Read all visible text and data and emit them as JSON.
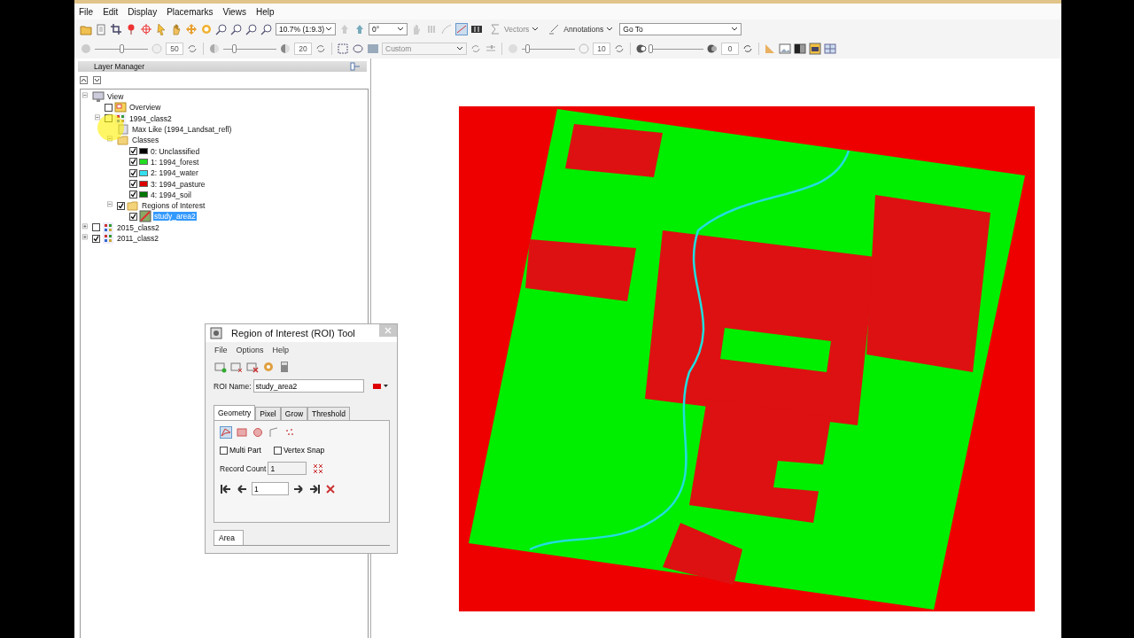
{
  "menu": [
    "File",
    "Edit",
    "Display",
    "Placemarks",
    "Views",
    "Help"
  ],
  "toolbar": {
    "zoom": "10.7% (1:9.3)",
    "rotation": "0°",
    "vectors": "Vectors",
    "annotations": "Annotations",
    "goto": "Go To"
  },
  "adjust_bar": {
    "sliders": [
      {
        "level": 0.5,
        "reading": "50"
      },
      {
        "level": 0.2,
        "reading": "20"
      }
    ],
    "stretch": "Custom",
    "sliders2": [
      {
        "level": 0.1,
        "reading": "10"
      },
      {
        "level": 0.0,
        "reading": "0"
      }
    ]
  },
  "layer_manager": {
    "title": "Layer Manager",
    "tree": [
      {
        "label": "View",
        "kind": "view",
        "expanded": true,
        "selected": false,
        "children": [
          {
            "label": "Overview",
            "kind": "overview",
            "checked": false,
            "selected": false
          },
          {
            "label": "1994_class2",
            "kind": "layer",
            "checked": false,
            "expanded": true,
            "selected": false,
            "children": [
              {
                "label": "Max Like (1994_Landsat_refl)",
                "kind": "file",
                "selected": false
              },
              {
                "label": "Classes",
                "kind": "folder",
                "expanded": true,
                "selected": false,
                "children": [
                  {
                    "label": "0: Unclassified",
                    "kind": "class",
                    "checked": true,
                    "color": "#000000",
                    "selected": false
                  },
                  {
                    "label": "1: 1994_forest",
                    "kind": "class",
                    "checked": true,
                    "color": "#22dd22",
                    "selected": false
                  },
                  {
                    "label": "2: 1994_water",
                    "kind": "class",
                    "checked": true,
                    "color": "#33e0f0",
                    "selected": false
                  },
                  {
                    "label": "3: 1994_pasture",
                    "kind": "class",
                    "checked": true,
                    "color": "#dd0000",
                    "selected": false
                  },
                  {
                    "label": "4: 1994_soil",
                    "kind": "class",
                    "checked": true,
                    "color": "#007700",
                    "selected": false
                  }
                ]
              },
              {
                "label": "Regions of Interest",
                "kind": "folder",
                "checked": true,
                "expanded": true,
                "selected": false,
                "children": [
                  {
                    "label": "study_area2",
                    "kind": "roi",
                    "checked": true,
                    "selected": true
                  }
                ]
              }
            ]
          }
        ]
      },
      {
        "label": "2015_class2",
        "kind": "layer",
        "checked": false,
        "expanded": false,
        "selected": false
      },
      {
        "label": "2011_class2",
        "kind": "layer",
        "checked": true,
        "expanded": false,
        "selected": false
      }
    ]
  },
  "roi_tool": {
    "title": "Region of Interest (ROI) Tool",
    "menu": [
      "File",
      "Options",
      "Help"
    ],
    "name_label": "ROI Name:",
    "name_value": "study_area2",
    "color": "#dd0000",
    "tabs": [
      {
        "label": "Geometry",
        "selected": true
      },
      {
        "label": "Pixel",
        "selected": false
      },
      {
        "label": "Grow",
        "selected": false
      },
      {
        "label": "Threshold",
        "selected": false
      }
    ],
    "options": [
      {
        "label": "Multi Part",
        "checked": false
      },
      {
        "label": "Vertex Snap",
        "checked": false
      }
    ],
    "record_count_label": "Record Count",
    "record_count": "1",
    "record_index": "1",
    "bottom_tabs": [
      {
        "label": "Area",
        "selected": true
      }
    ]
  }
}
